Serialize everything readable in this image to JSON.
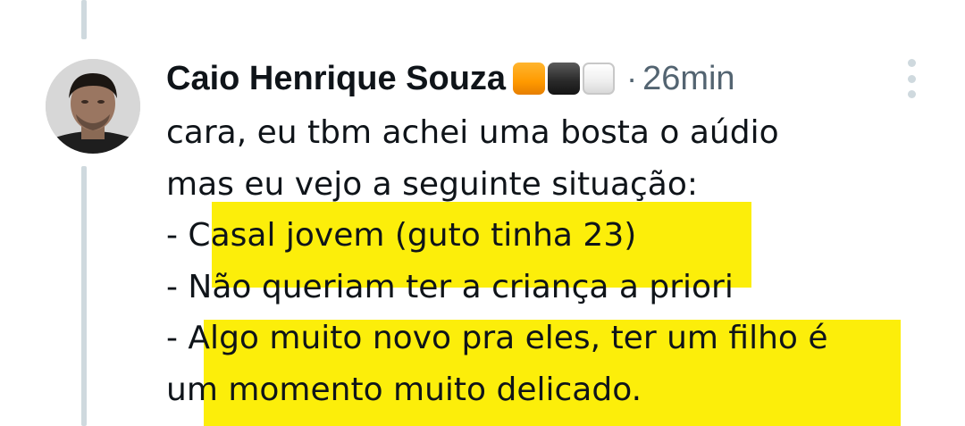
{
  "tweet": {
    "author_name": "Caio Henrique Souza",
    "author_badges": [
      "orange-square",
      "black-square",
      "white-square"
    ],
    "separator": "·",
    "timestamp": "26min",
    "lines": [
      "cara, eu tbm achei uma bosta o aúdio",
      "mas eu vejo a seguinte situação:",
      "- Casal jovem (guto tinha 23)",
      "- Não queriam ter a criança a priori",
      "- Algo muito novo pra eles, ter um filho é",
      "um momento muito delicado."
    ]
  },
  "colors": {
    "highlight": "#fcee0a",
    "thread_line": "#cfd9de",
    "text": "#0f1419",
    "secondary_text": "#536471"
  },
  "icons": {
    "more": "more-vertical-icon"
  }
}
